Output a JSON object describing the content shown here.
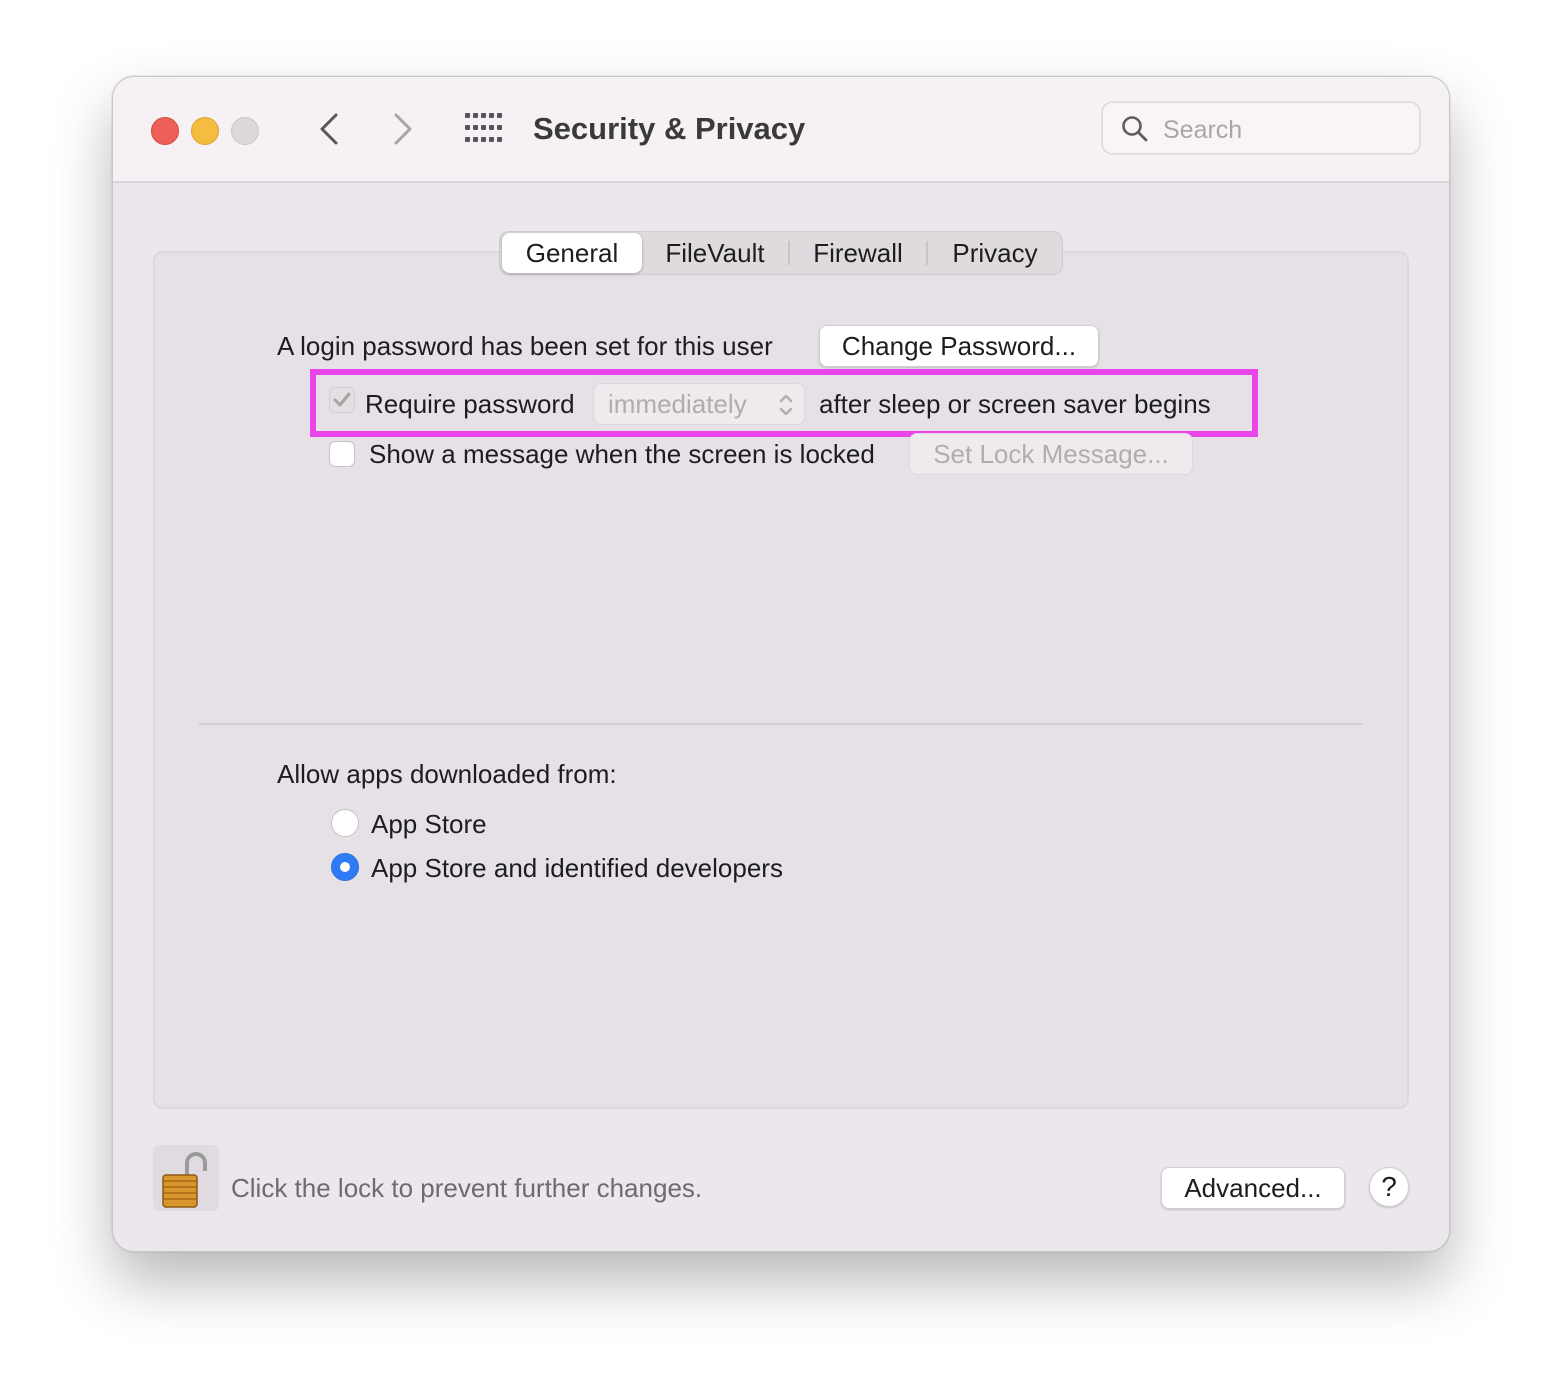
{
  "window": {
    "title": "Security & Privacy",
    "search_placeholder": "Search"
  },
  "tabs": [
    {
      "label": "General",
      "active": true
    },
    {
      "label": "FileVault",
      "active": false
    },
    {
      "label": "Firewall",
      "active": false
    },
    {
      "label": "Privacy",
      "active": false
    }
  ],
  "general": {
    "login_password_text": "A login password has been set for this user",
    "change_password_label": "Change Password...",
    "require_password": {
      "label": "Require password",
      "checked": true,
      "enabled": false,
      "delay_value": "immediately",
      "suffix": "after sleep or screen saver begins"
    },
    "lock_message": {
      "label": "Show a message when the screen is locked",
      "checked": false,
      "button_label": "Set Lock Message..."
    },
    "allow_apps": {
      "heading": "Allow apps downloaded from:",
      "options": [
        {
          "label": "App Store",
          "selected": false
        },
        {
          "label": "App Store and identified developers",
          "selected": true
        }
      ]
    }
  },
  "footer": {
    "lock_text": "Click the lock to prevent further changes.",
    "advanced_label": "Advanced...",
    "help_label": "?"
  },
  "colors": {
    "highlight": "#ea45ea",
    "accent": "#2f7bf6",
    "close": "#ee5f57",
    "minimize": "#f5bd3f"
  },
  "icons": [
    "search-icon",
    "chevron-left-icon",
    "chevron-right-icon",
    "grid-icon",
    "unlocked-padlock-icon",
    "chevrons-up-down-icon",
    "checkmark-icon"
  ]
}
